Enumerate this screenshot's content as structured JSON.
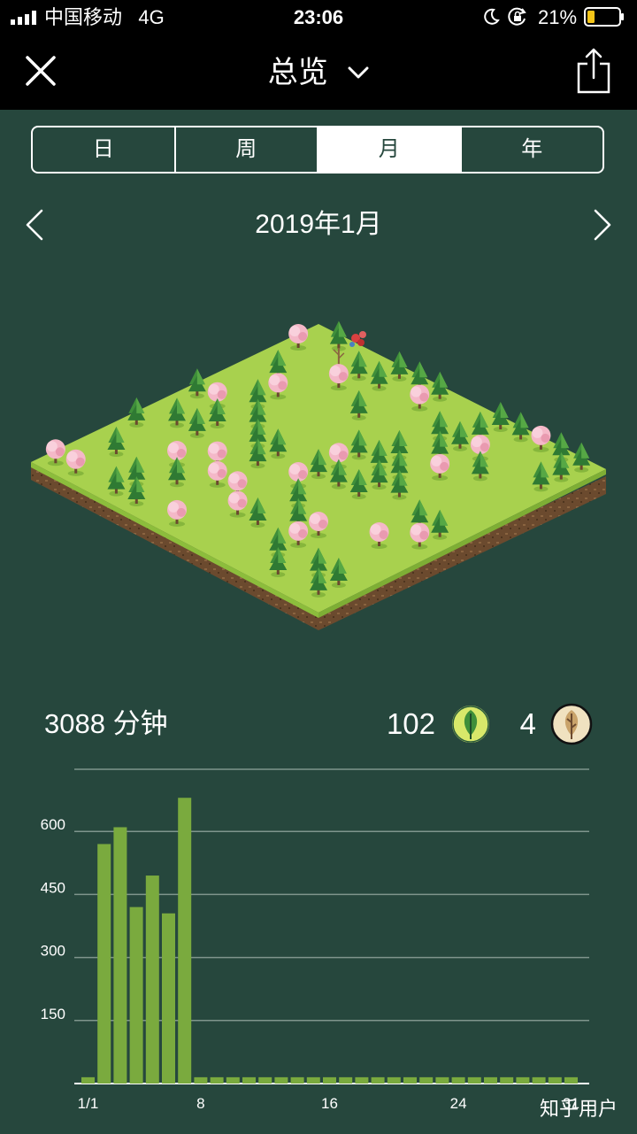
{
  "status_bar": {
    "carrier": "中国移动",
    "network": "4G",
    "time": "23:06",
    "battery": "21%",
    "icons": [
      "signal-icon",
      "moon-icon",
      "orientation-lock-icon",
      "battery-icon"
    ]
  },
  "nav": {
    "title": "总览",
    "icons": [
      "close-icon",
      "chevron-down-icon",
      "share-icon"
    ]
  },
  "tabs": [
    {
      "label": "日",
      "active": false
    },
    {
      "label": "周",
      "active": false
    },
    {
      "label": "月",
      "active": true
    },
    {
      "label": "年",
      "active": false
    }
  ],
  "period": {
    "label": "2019年1月",
    "icons": [
      "chevron-left-icon",
      "chevron-right-icon"
    ]
  },
  "stats": {
    "minutes_label": "3088 分钟",
    "healthy_trees": "102",
    "dead_trees": "4",
    "icons": [
      "healthy-tree-icon",
      "dead-tree-icon"
    ]
  },
  "colors": {
    "background": "#26473d",
    "bar": "#7aaa3e",
    "grass": "#a8d14e"
  },
  "chart_data": {
    "type": "bar",
    "categories": [
      1,
      2,
      3,
      4,
      5,
      6,
      7,
      8,
      9,
      10,
      11,
      12,
      13,
      14,
      15,
      16,
      17,
      18,
      19,
      20,
      21,
      22,
      23,
      24,
      25,
      26,
      27,
      28,
      29,
      30,
      31
    ],
    "values": [
      15,
      570,
      610,
      420,
      495,
      405,
      680,
      15,
      15,
      15,
      15,
      15,
      15,
      15,
      15,
      15,
      15,
      15,
      15,
      15,
      15,
      15,
      15,
      15,
      15,
      15,
      15,
      15,
      15,
      15,
      15
    ],
    "x_tick_labels": [
      "1/1",
      "8",
      "16",
      "24",
      "31"
    ],
    "y_tick_labels": [
      "150",
      "300",
      "450",
      "600"
    ],
    "ylim": [
      0,
      750
    ],
    "grid": true
  },
  "watermark": "知乎用户"
}
